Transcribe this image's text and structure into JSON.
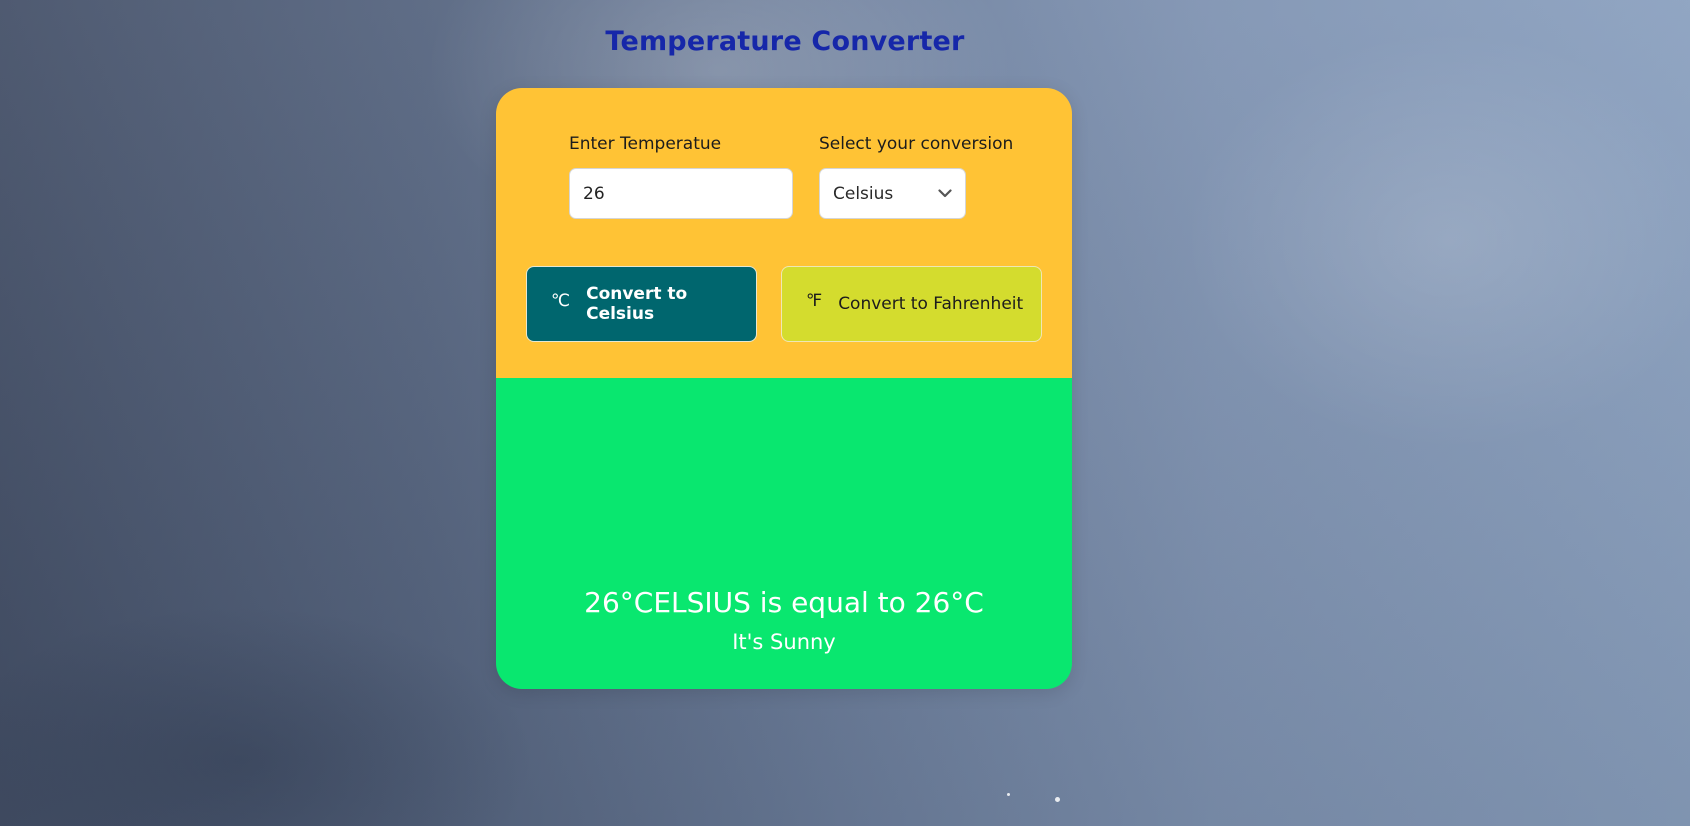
{
  "page": {
    "title": "Temperature Converter"
  },
  "form": {
    "temperature_label": "Enter Temperatue",
    "temperature_value": "26",
    "conversion_label": "Select your conversion",
    "conversion_selected": "Celsius",
    "chevron_icon": "chevron-down-icon"
  },
  "buttons": {
    "celsius": {
      "icon": "℃",
      "label": "Convert to Celsius"
    },
    "fahrenheit": {
      "icon": "℉",
      "label": "Convert to Fahrenheit"
    }
  },
  "result": {
    "text": "26°CELSIUS is equal to 26°C",
    "weather": "It's Sunny"
  },
  "colors": {
    "title": "#1627a9",
    "panel_top": "#ffc335",
    "panel_bottom": "#09e76f",
    "celsius_button": "#00666e",
    "fahrenheit_button": "#d4dc2e"
  }
}
